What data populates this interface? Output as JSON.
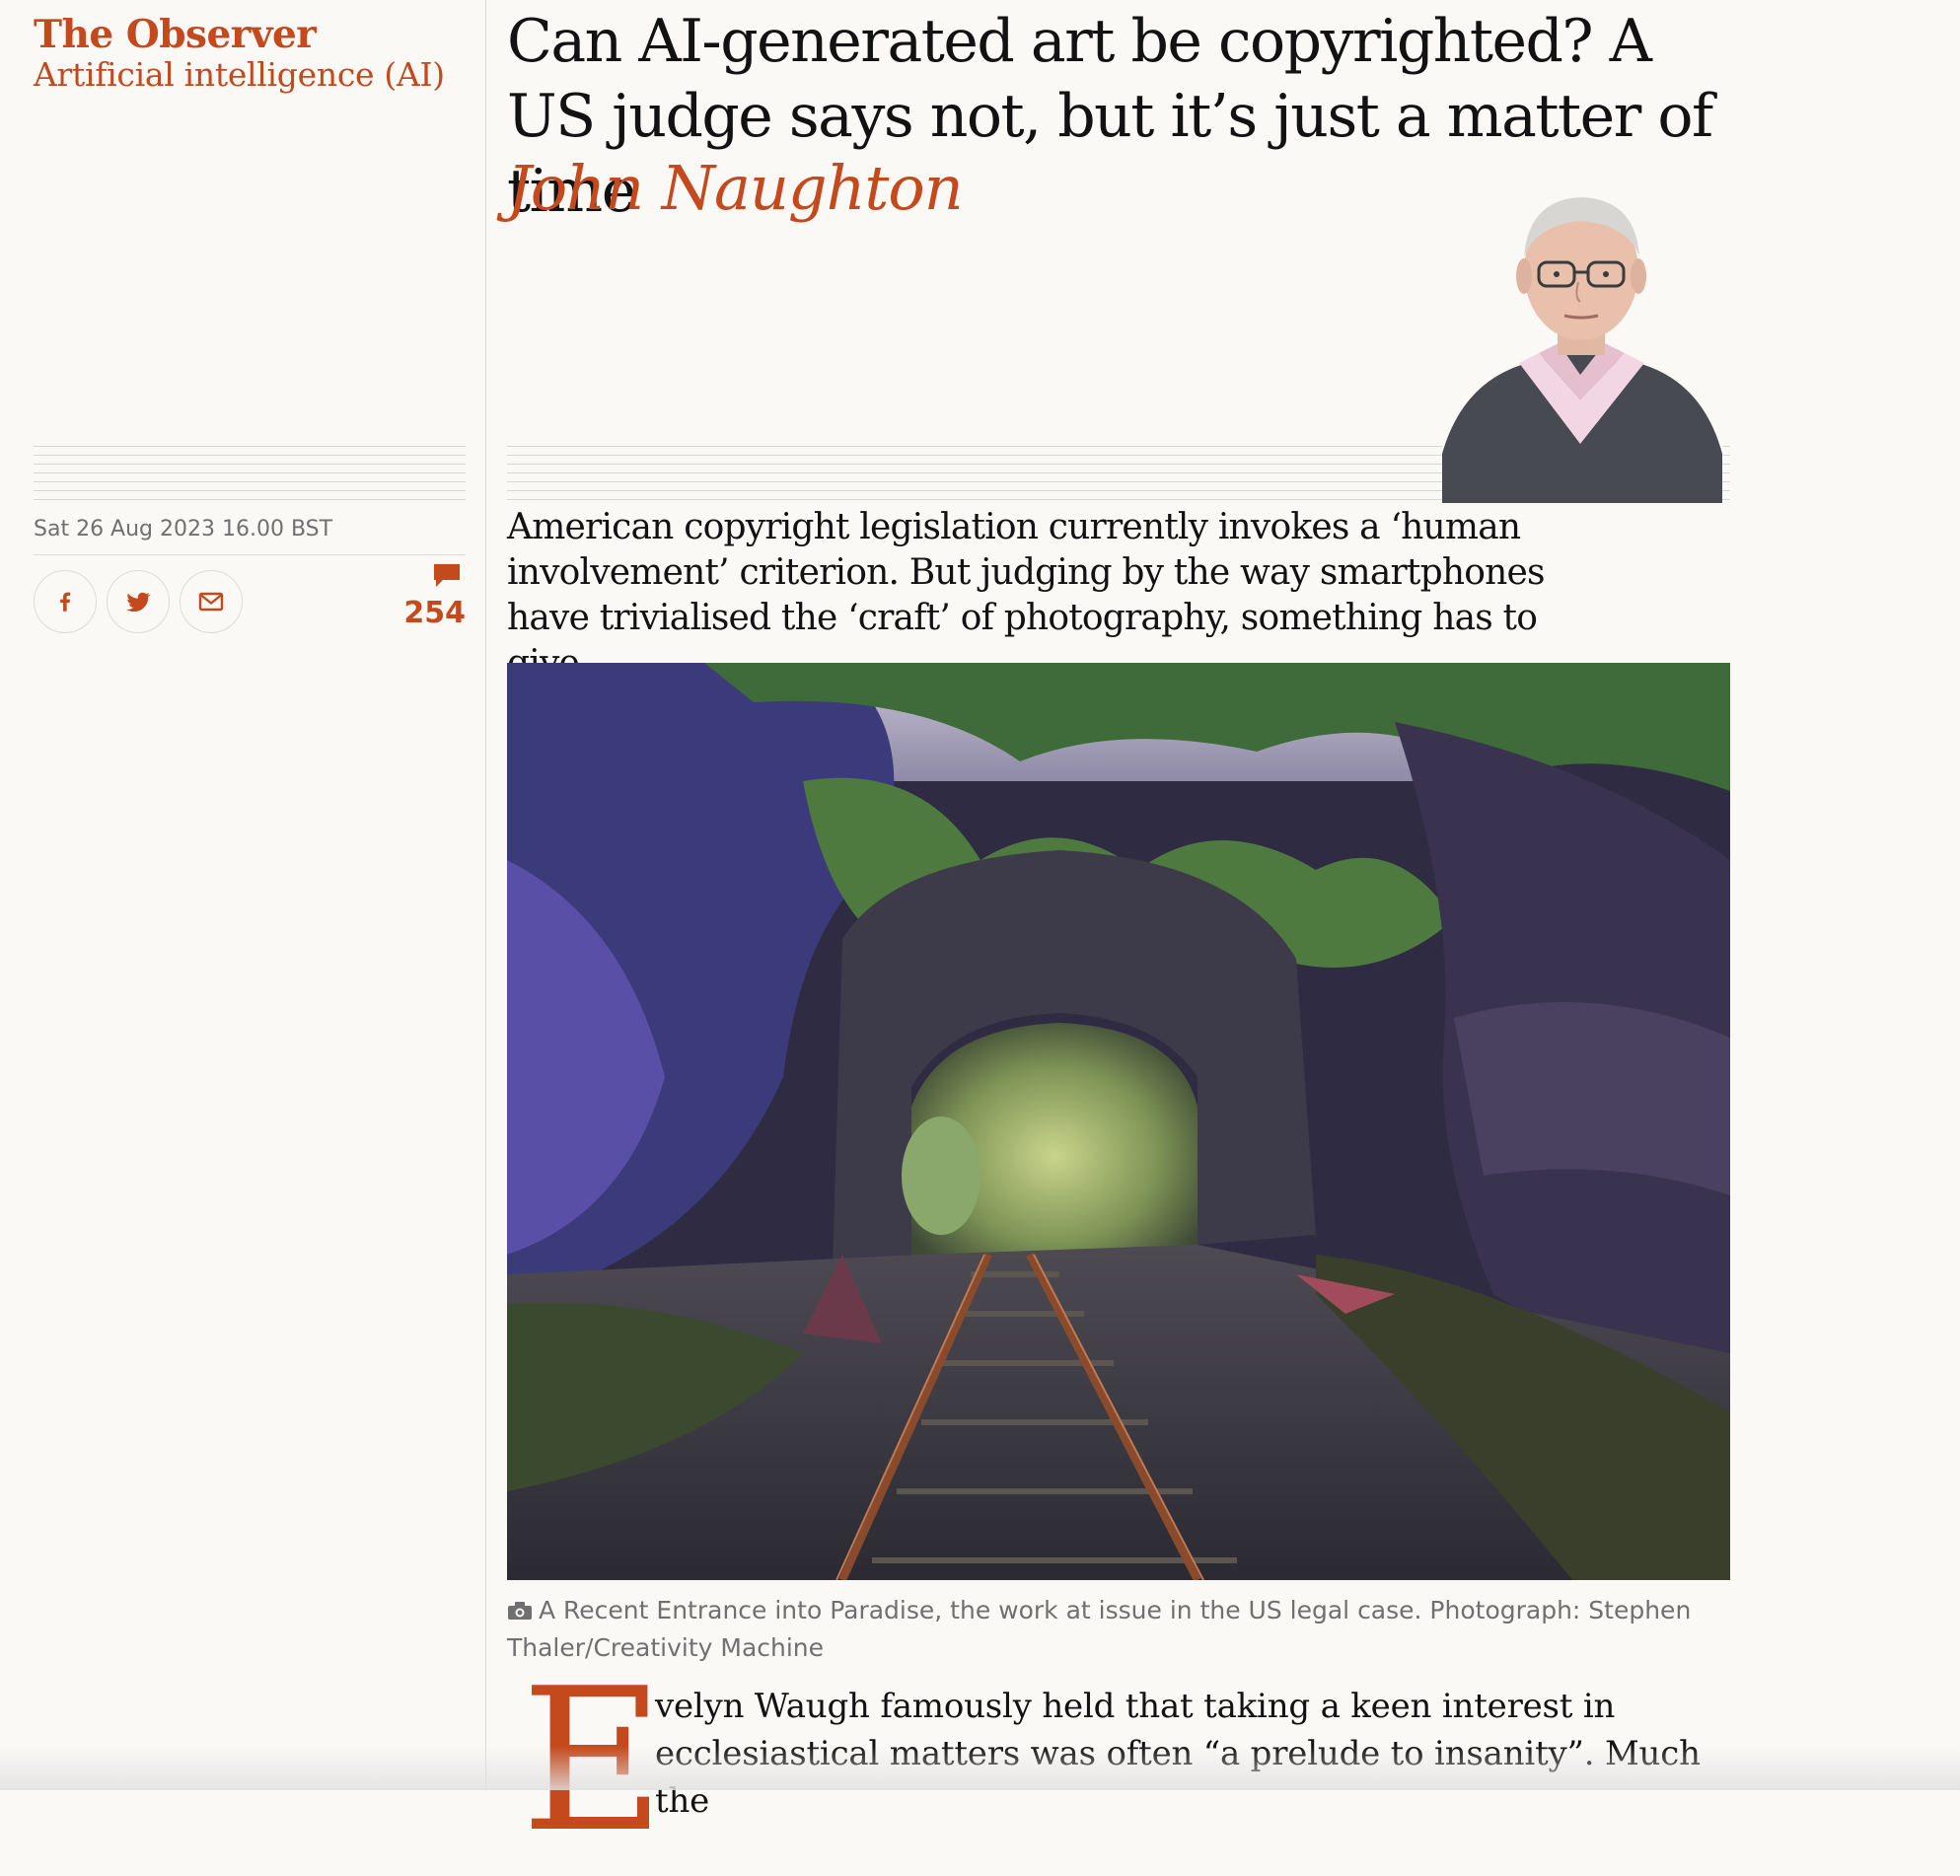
{
  "header": {
    "brand": "The Observer",
    "section": "Artificial intelligence (AI)"
  },
  "meta": {
    "date": "Sat 26 Aug 2023 16.00 BST",
    "comment_count": "254"
  },
  "share": {
    "facebook_icon": "facebook-icon",
    "twitter_icon": "twitter-icon",
    "email_icon": "email-icon"
  },
  "article": {
    "headline": "Can AI-generated art be copyrighted? A US judge says not, but it’s just a matter of time",
    "byline": "John Naughton",
    "standfirst": "American copyright legislation currently invokes a ‘human involvement’ criterion. But judging by the way smartphones have trivialised the ‘craft’ of photography, something has to give",
    "caption": "A Recent Entrance into Paradise, the work at issue in the US legal case. Photograph: Stephen Thaler/Creativity Machine",
    "dropcap": "E",
    "body": "velyn Waugh famously held that taking a keen interest in ecclesiastical matters was often “a prelude to insanity”. Much the"
  },
  "colors": {
    "accent": "#c4491d",
    "background": "#fbf9f6",
    "text": "#121212",
    "muted": "#707070"
  }
}
